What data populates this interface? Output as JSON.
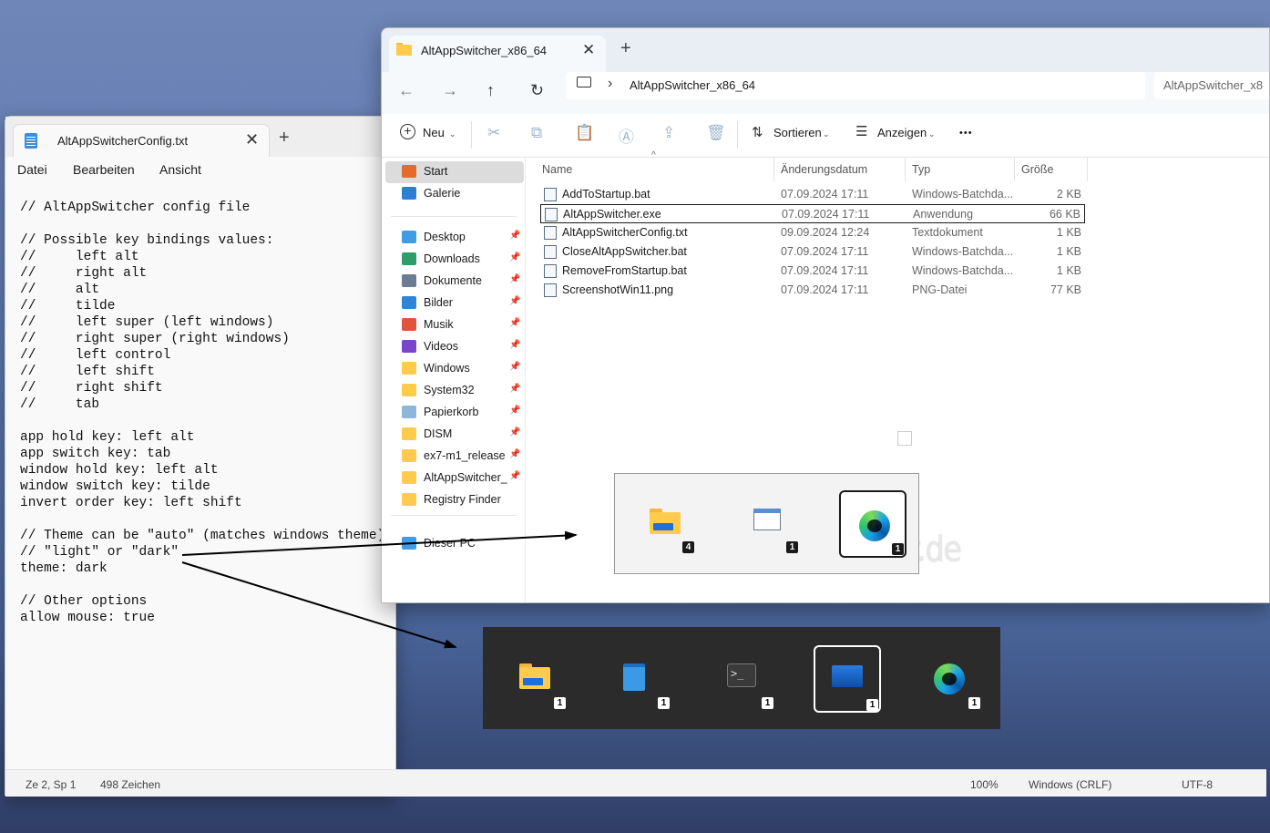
{
  "notepad": {
    "tab_title": "AltAppSwitcherConfig.txt",
    "close_glyph": "✕",
    "new_tab_glyph": "+",
    "menu": [
      "Datei",
      "Bearbeiten",
      "Ansicht"
    ],
    "lines": [
      "// AltAppSwitcher config file",
      "",
      "// Possible key bindings values:",
      "//     left alt",
      "//     right alt",
      "//     alt",
      "//     tilde",
      "//     left super (left windows)",
      "//     right super (right windows)",
      "//     left control",
      "//     left shift",
      "//     right shift",
      "//     tab",
      "",
      "app hold key: left alt",
      "app switch key: tab",
      "window hold key: left alt",
      "window switch key: tilde",
      "invert order key: left shift",
      "",
      "// Theme can be \"auto\" (matches windows theme),",
      "// \"light\" or \"dark\"",
      "theme: dark",
      "",
      "// Other options",
      "allow mouse: true"
    ],
    "status": {
      "position": "Ze 2, Sp 1",
      "chars": "498 Zeichen",
      "zoom": "100%",
      "line_ending": "Windows (CRLF)",
      "encoding": "UTF-8"
    }
  },
  "explorer": {
    "tab_title": "AltAppSwitcher_x86_64",
    "close_glyph": "✕",
    "new_tab_glyph": "+",
    "nav": {
      "back": "←",
      "forward": "→",
      "up": "↑",
      "refresh": "↻",
      "chevron": "›"
    },
    "address": "AltAppSwitcher_x86_64",
    "search_text": "AltAppSwitcher_x8",
    "toolbar": {
      "new_label": "Neu",
      "sort_label": "Sortieren",
      "view_label": "Anzeigen",
      "more": "•••"
    },
    "sidebar": [
      {
        "label": "Start",
        "icon": "home-icon",
        "color": "#e46b2c",
        "pinned": false
      },
      {
        "label": "Galerie",
        "icon": "gallery-icon",
        "color": "#2d7fd6",
        "pinned": false
      },
      {
        "label": "Desktop",
        "icon": "desktop-icon",
        "color": "#3f9de8",
        "pinned": true
      },
      {
        "label": "Downloads",
        "icon": "download-icon",
        "color": "#2f9c6b",
        "pinned": true
      },
      {
        "label": "Dokumente",
        "icon": "document-icon",
        "color": "#6b7c93",
        "pinned": true
      },
      {
        "label": "Bilder",
        "icon": "pictures-icon",
        "color": "#2f86d8",
        "pinned": true
      },
      {
        "label": "Musik",
        "icon": "music-icon",
        "color": "#e0533d",
        "pinned": true
      },
      {
        "label": "Videos",
        "icon": "video-icon",
        "color": "#7a46c9",
        "pinned": true
      },
      {
        "label": "Windows",
        "icon": "folder-icon",
        "color": "#ffcb4c",
        "pinned": true
      },
      {
        "label": "System32",
        "icon": "folder-icon",
        "color": "#ffcb4c",
        "pinned": true
      },
      {
        "label": "Papierkorb",
        "icon": "recycle-bin-icon",
        "color": "#8fb6d9",
        "pinned": true
      },
      {
        "label": "DISM",
        "icon": "folder-icon",
        "color": "#ffcb4c",
        "pinned": true
      },
      {
        "label": "ex7-m1_release",
        "icon": "folder-icon",
        "color": "#ffcb4c",
        "pinned": true
      },
      {
        "label": "AltAppSwitcher_x",
        "icon": "folder-icon",
        "color": "#ffcb4c",
        "pinned": true
      },
      {
        "label": "Registry Finder",
        "icon": "folder-icon",
        "color": "#ffcb4c",
        "pinned": false
      },
      {
        "label": "Dieser PC",
        "icon": "pc-icon",
        "color": "#3f9de8",
        "pinned": false
      }
    ],
    "columns": {
      "name": "Name",
      "date": "Änderungsdatum",
      "type": "Typ",
      "size": "Größe"
    },
    "files": [
      {
        "name": "AddToStartup.bat",
        "date": "07.09.2024 17:11",
        "type": "Windows-Batchda...",
        "size": "2 KB"
      },
      {
        "name": "AltAppSwitcher.exe",
        "date": "07.09.2024 17:11",
        "type": "Anwendung",
        "size": "66 KB"
      },
      {
        "name": "AltAppSwitcherConfig.txt",
        "date": "09.09.2024 12:24",
        "type": "Textdokument",
        "size": "1 KB"
      },
      {
        "name": "CloseAltAppSwitcher.bat",
        "date": "07.09.2024 17:11",
        "type": "Windows-Batchda...",
        "size": "1 KB"
      },
      {
        "name": "RemoveFromStartup.bat",
        "date": "07.09.2024 17:11",
        "type": "Windows-Batchda...",
        "size": "1 KB"
      },
      {
        "name": "ScreenshotWin11.png",
        "date": "07.09.2024 17:11",
        "type": "PNG-Datei",
        "size": "77 KB"
      }
    ],
    "watermark": "Deskmodder.de"
  },
  "switcher_light": {
    "items": [
      {
        "icon": "file-explorer-icon",
        "count": "4"
      },
      {
        "icon": "app-window-icon",
        "count": "1"
      },
      {
        "icon": "edge-icon",
        "count": "1"
      }
    ]
  },
  "switcher_dark": {
    "items": [
      {
        "icon": "file-explorer-icon",
        "count": "1"
      },
      {
        "icon": "notepad-icon",
        "count": "1"
      },
      {
        "icon": "terminal-icon",
        "count": "1"
      },
      {
        "icon": "resource-monitor-icon",
        "count": "1"
      },
      {
        "icon": "edge-icon",
        "count": "1"
      }
    ]
  },
  "colors": {
    "desktop_top": "#6f86b8",
    "desktop_bottom": "#2f3e66",
    "dark_switcher_bg": "#2b2b2b",
    "light_switcher_bg": "#f3f3f3",
    "spell_underline": "#d13438"
  }
}
